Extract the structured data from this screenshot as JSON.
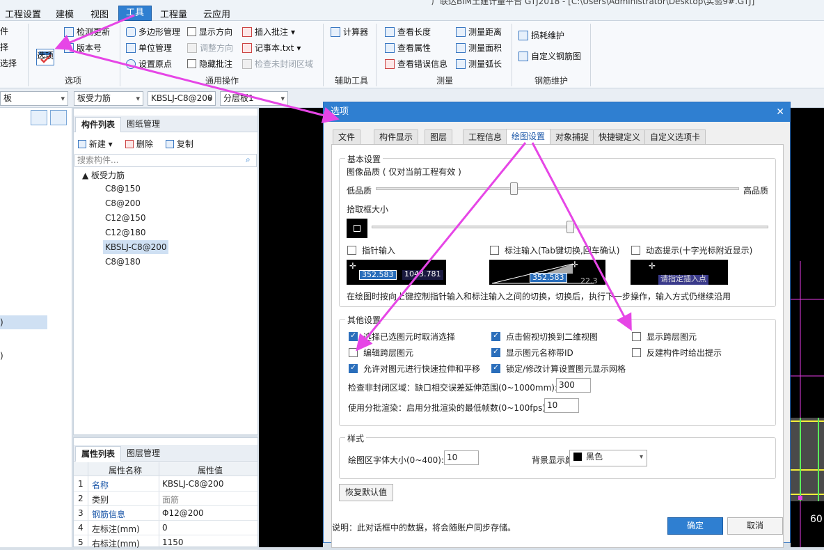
{
  "window_title": "广联达BIM土建计量平台 GTJ2018 - [C:\\Users\\Administrator\\Desktop\\实验9#.GTJ]",
  "menu": {
    "items": [
      "工程设置",
      "建模",
      "视图",
      "工具",
      "工程量",
      "云应用"
    ],
    "active": "工具"
  },
  "ribbon": {
    "left_partial": [
      "件",
      "择",
      "选择"
    ],
    "options_button": "选项",
    "check_update": "检测更新",
    "version": "版本号",
    "group_options": "选项",
    "polygon_manage": "多边形管理",
    "unit_manage": "单位管理",
    "set_origin": "设置原点",
    "show_direction": "显示方向",
    "adjust_direction": "调整方向",
    "hide_annotation": "隐藏批注",
    "insert_annotation": "插入批注",
    "notepad": "记事本.txt",
    "check_unclosed": "检查未封闭区域",
    "group_general": "通用操作",
    "calculator": "计算器",
    "group_aux": "辅助工具",
    "view_length": "查看长度",
    "view_property": "查看属性",
    "view_error": "查看错误信息",
    "measure_distance": "测量距离",
    "measure_area": "测量面积",
    "measure_arc": "测量弧长",
    "group_measure": "测量",
    "loss_maintain": "损耗维护",
    "custom_rebar": "自定义钢筋图",
    "group_rebar": "钢筋维护"
  },
  "toolbar2": {
    "combo1": "板",
    "combo2": "板受力筋",
    "combo3": "KBSLJ-C8@200",
    "combo4": "分层板1"
  },
  "left_pane": {
    "item1": ")",
    "item2": ")"
  },
  "component_panel": {
    "tabs": [
      "构件列表",
      "图纸管理"
    ],
    "new": "新建",
    "delete": "删除",
    "copy": "复制",
    "search_placeholder": "搜索构件...",
    "tree_root": "板受力筋",
    "items": [
      "C8@150",
      "C8@200",
      "C12@150",
      "C12@180",
      "KBSLJ-C8@200",
      "C8@180"
    ],
    "selected": "KBSLJ-C8@200"
  },
  "property_panel": {
    "tabs": [
      "属性列表",
      "图层管理"
    ],
    "col_name": "属性名称",
    "col_value": "属性值",
    "rows": [
      {
        "no": "1",
        "name": "名称",
        "value": "KBSLJ-C8@200"
      },
      {
        "no": "2",
        "name": "类别",
        "value": "面筋"
      },
      {
        "no": "3",
        "name": "钢筋信息",
        "value": "Φ12@200"
      },
      {
        "no": "4",
        "name": "左标注(mm)",
        "value": "0"
      },
      {
        "no": "5",
        "name": "右标注(mm)",
        "value": "1150"
      }
    ]
  },
  "canvas": {
    "number": "60"
  },
  "dialog": {
    "title": "选项",
    "close": "✕",
    "tabs": [
      "文件",
      "构件显示",
      "图层",
      "工程信息",
      "绘图设置",
      "对象捕捉",
      "快捷键定义",
      "自定义选项卡"
    ],
    "active_tab": "绘图设置",
    "basic": {
      "title": "基本设置",
      "image_quality": "图像品质 ( 仅对当前工程有效 )",
      "low_quality": "低品质",
      "high_quality": "高品质",
      "image_quality_level": 0.38,
      "pick_box": "拾取框大小",
      "pick_box_level": 0.5,
      "pointer_input": "指针输入",
      "dim_input": "标注输入(Tab键切换,回车确认)",
      "dynamic_hint": "动态提示(十字光标附近显示)",
      "preview1_a": "352.583",
      "preview1_b": "1043.781",
      "preview2_a": "352.583",
      "preview2_b": "22.3",
      "preview3_a": "请指定插入点",
      "tip": "在绘图时按向上键控制指针输入和标注输入之间的切换，切换后，执行下一步操作，输入方式仍继续沿用"
    },
    "other": {
      "title": "其他设置",
      "cb1": "选择已选图元时取消选择",
      "cb2": "点击俯视切换到二维视图",
      "cb3": "显示跨层图元",
      "cb4": "编辑跨层图元",
      "cb5": "显示图元名称带ID",
      "cb6": "反建构件时给出提示",
      "cb7": "允许对图元进行快速拉伸和平移",
      "cb8": "锁定/修改计算设置图元显示网格",
      "check_label": "检查非封闭区域：缺口相交误差延伸范围(0~1000mm):",
      "check_value": "300",
      "render_label": "使用分批渲染：启用分批渲染的最低帧数(0~100fps):",
      "render_value": "10"
    },
    "style": {
      "title": "样式",
      "font_label": "绘图区字体大小(0~400):",
      "font_value": "10",
      "bg_label": "背景显示颜色:",
      "bg_value": "黑色",
      "bg_color": "#000000"
    },
    "restore": "恢复默认值",
    "note": "说明：此对话框中的数据，将会随账户同步存储。",
    "ok": "确定",
    "cancel": "取消"
  },
  "colors": {
    "accent": "#2f7fd1",
    "arrow": "#e646e6"
  }
}
